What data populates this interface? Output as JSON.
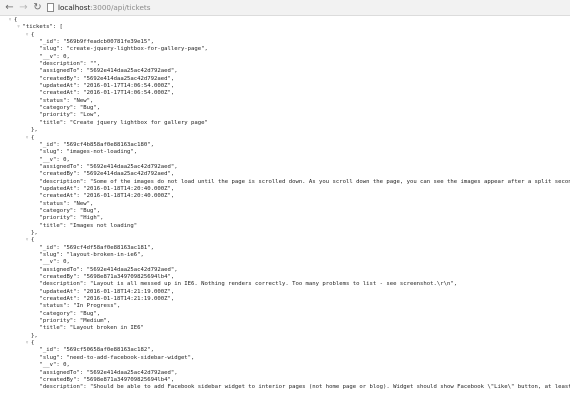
{
  "browser": {
    "back_icon": "←",
    "forward_icon": "→",
    "reload_icon": "↻",
    "url_host": "localhost",
    "url_path": ":3000/api/tickets"
  },
  "json_lines": [
    {
      "indent": 0,
      "fold": "▿",
      "text": "{"
    },
    {
      "indent": 1,
      "fold": "▿",
      "text": "\"tickets\": ["
    },
    {
      "indent": 2,
      "fold": "▿",
      "text": "{"
    },
    {
      "indent": 3,
      "fold": "",
      "text": "\"_id\": \"569b9ffeadcb00781fe39e15\","
    },
    {
      "indent": 3,
      "fold": "",
      "text": "\"slug\": \"create-jquery-lightbox-for-gallery-page\","
    },
    {
      "indent": 3,
      "fold": "",
      "text": "\"__v\": 0,"
    },
    {
      "indent": 3,
      "fold": "",
      "text": "\"description\": \"\","
    },
    {
      "indent": 3,
      "fold": "",
      "text": "\"assignedTo\": \"5692e414daa25ac42d792aed\","
    },
    {
      "indent": 3,
      "fold": "",
      "text": "\"createdBy\": \"5692e414daa25ac42d792aed\","
    },
    {
      "indent": 3,
      "fold": "",
      "text": "\"updatedAt\": \"2016-01-17T14:06:54.000Z\","
    },
    {
      "indent": 3,
      "fold": "",
      "text": "\"createdAt\": \"2016-01-17T14:06:54.000Z\","
    },
    {
      "indent": 3,
      "fold": "",
      "text": "\"status\": \"New\","
    },
    {
      "indent": 3,
      "fold": "",
      "text": "\"category\": \"Bug\","
    },
    {
      "indent": 3,
      "fold": "",
      "text": "\"priority\": \"Low\","
    },
    {
      "indent": 3,
      "fold": "",
      "text": "\"title\": \"Create jquery lightbox for gallery page\""
    },
    {
      "indent": 2,
      "fold": "",
      "text": "},"
    },
    {
      "indent": 2,
      "fold": "▿",
      "text": "{"
    },
    {
      "indent": 3,
      "fold": "",
      "text": "\"_id\": \"569cf4b858af0e88163ac180\","
    },
    {
      "indent": 3,
      "fold": "",
      "text": "\"slug\": \"images-not-loading\","
    },
    {
      "indent": 3,
      "fold": "",
      "text": "\"__v\": 0,"
    },
    {
      "indent": 3,
      "fold": "",
      "text": "\"assignedTo\": \"5692e414daa25ac42d792aed\","
    },
    {
      "indent": 3,
      "fold": "",
      "text": "\"createdBy\": \"5692e414daa25ac42d792aed\","
    },
    {
      "indent": 3,
      "fold": "",
      "text": "\"description\": \"Some of the images do not load until the page is scrolled down. As you scroll down the page, you can see the images appear after a split second. Not sure"
    },
    {
      "indent": 3,
      "fold": "",
      "text": "\"updatedAt\": \"2016-01-18T14:20:40.000Z\","
    },
    {
      "indent": 3,
      "fold": "",
      "text": "\"createdAt\": \"2016-01-18T14:20:40.000Z\","
    },
    {
      "indent": 3,
      "fold": "",
      "text": "\"status\": \"New\","
    },
    {
      "indent": 3,
      "fold": "",
      "text": "\"category\": \"Bug\","
    },
    {
      "indent": 3,
      "fold": "",
      "text": "\"priority\": \"High\","
    },
    {
      "indent": 3,
      "fold": "",
      "text": "\"title\": \"Images not loading\""
    },
    {
      "indent": 2,
      "fold": "",
      "text": "},"
    },
    {
      "indent": 2,
      "fold": "▿",
      "text": "{"
    },
    {
      "indent": 3,
      "fold": "",
      "text": "\"_id\": \"569cf4df58af0e88163ac181\","
    },
    {
      "indent": 3,
      "fold": "",
      "text": "\"slug\": \"layout-broken-in-ie6\","
    },
    {
      "indent": 3,
      "fold": "",
      "text": "\"__v\": 0,"
    },
    {
      "indent": 3,
      "fold": "",
      "text": "\"assignedTo\": \"5692e414daa25ac42d792aed\","
    },
    {
      "indent": 3,
      "fold": "",
      "text": "\"createdBy\": \"5698e871a349709825694lb4\","
    },
    {
      "indent": 3,
      "fold": "",
      "text": "\"description\": \"Layout is all messed up in IE6. Nothing renders correctly. Too many problems to list - see screenshot.\\r\\n\","
    },
    {
      "indent": 3,
      "fold": "",
      "text": "\"updatedAt\": \"2016-01-18T14:21:19.000Z\","
    },
    {
      "indent": 3,
      "fold": "",
      "text": "\"createdAt\": \"2016-01-18T14:21:19.000Z\","
    },
    {
      "indent": 3,
      "fold": "",
      "text": "\"status\": \"In Progress\","
    },
    {
      "indent": 3,
      "fold": "",
      "text": "\"category\": \"Bug\","
    },
    {
      "indent": 3,
      "fold": "",
      "text": "\"priority\": \"Medium\","
    },
    {
      "indent": 3,
      "fold": "",
      "text": "\"title\": \"Layout broken in IE6\""
    },
    {
      "indent": 2,
      "fold": "",
      "text": "},"
    },
    {
      "indent": 2,
      "fold": "▿",
      "text": "{"
    },
    {
      "indent": 3,
      "fold": "",
      "text": "\"_id\": \"569cf50658af0e88163ac182\","
    },
    {
      "indent": 3,
      "fold": "",
      "text": "\"slug\": \"need-to-add-facebook-sidebar-widget\","
    },
    {
      "indent": 3,
      "fold": "",
      "text": "\"__v\": 0,"
    },
    {
      "indent": 3,
      "fold": "",
      "text": "\"assignedTo\": \"5692e414daa25ac42d792aed\","
    },
    {
      "indent": 3,
      "fold": "",
      "text": "\"createdBy\": \"5698e871a349709825694lb4\","
    },
    {
      "indent": 3,
      "fold": "",
      "text": "\"description\": \"Should be able to add Facebook sidebar widget to interior pages (not home page or blog). Widget should show Facebook \\\"Like\\\" button, at least six Facebook"
    }
  ]
}
